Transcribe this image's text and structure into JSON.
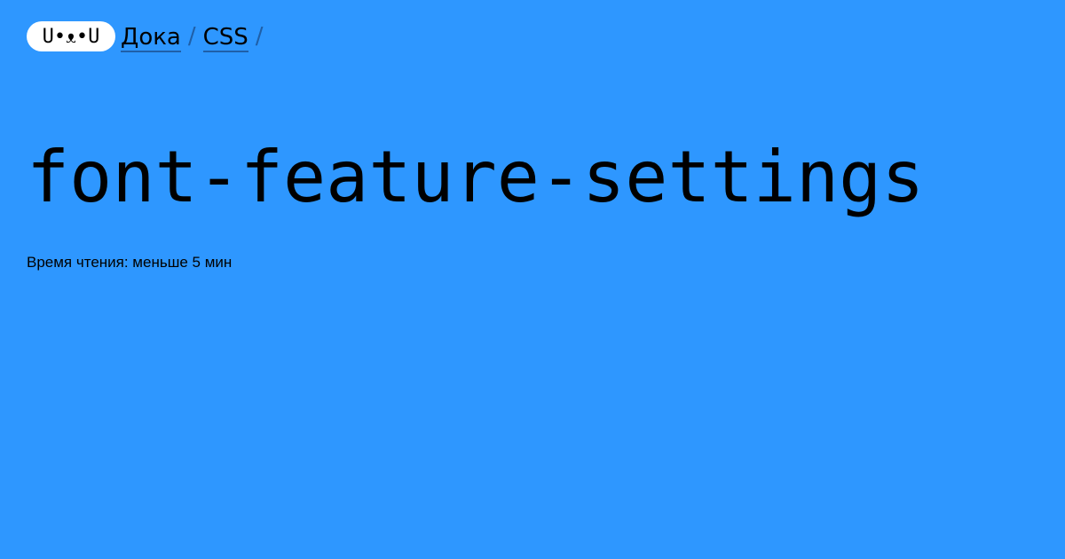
{
  "colors": {
    "background": "#2e97ff",
    "logo_background": "#ffffff",
    "text": "#000000",
    "underline": "#1f5fa8"
  },
  "header": {
    "logo_text": "U•ᴥ•U",
    "breadcrumb": [
      {
        "label": "Дока"
      },
      {
        "label": "CSS"
      }
    ],
    "separator": "/"
  },
  "main": {
    "title": "font-feature-settings",
    "reading_time": "Время чтения: меньше 5 мин"
  }
}
